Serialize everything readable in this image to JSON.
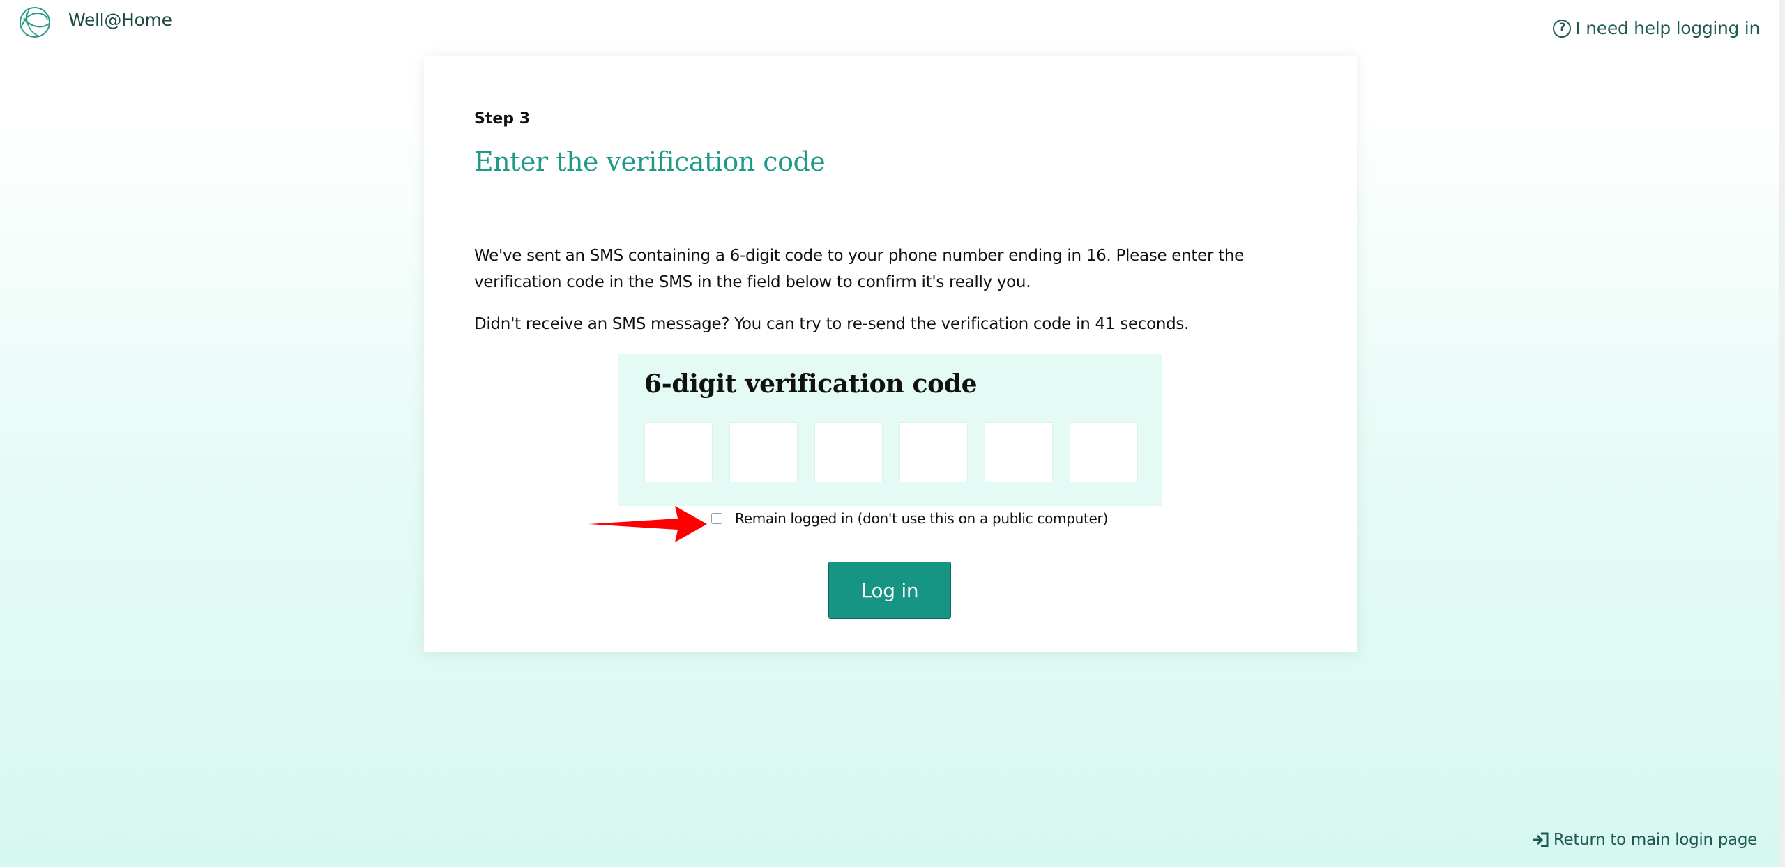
{
  "header": {
    "brand": "Well@Home",
    "help_link": "I need help logging in",
    "logo_icon": "well-at-home-logo"
  },
  "form": {
    "step": "Step 3",
    "title": "Enter the verification code",
    "description": "We've sent an SMS containing a 6-digit code to your phone number ending in 16. Please enter the verification code in the SMS in the field below to confirm it's really you.",
    "resend_info": "Didn't receive an SMS message? You can try to re-send the verification code in 41 seconds.",
    "code_label": "6-digit verification code",
    "digits": [
      "",
      "",
      "",
      "",
      "",
      ""
    ],
    "remain_logged_in_label": "Remain logged in (don't use this on a public computer)",
    "remain_logged_in_checked": false,
    "login_button": "Log in"
  },
  "footer": {
    "return_link": "Return to main login page"
  },
  "colors": {
    "accent": "#1e9a87",
    "button": "#169484",
    "panel": "#e4fbf5",
    "annotation_arrow": "#ff0000"
  }
}
